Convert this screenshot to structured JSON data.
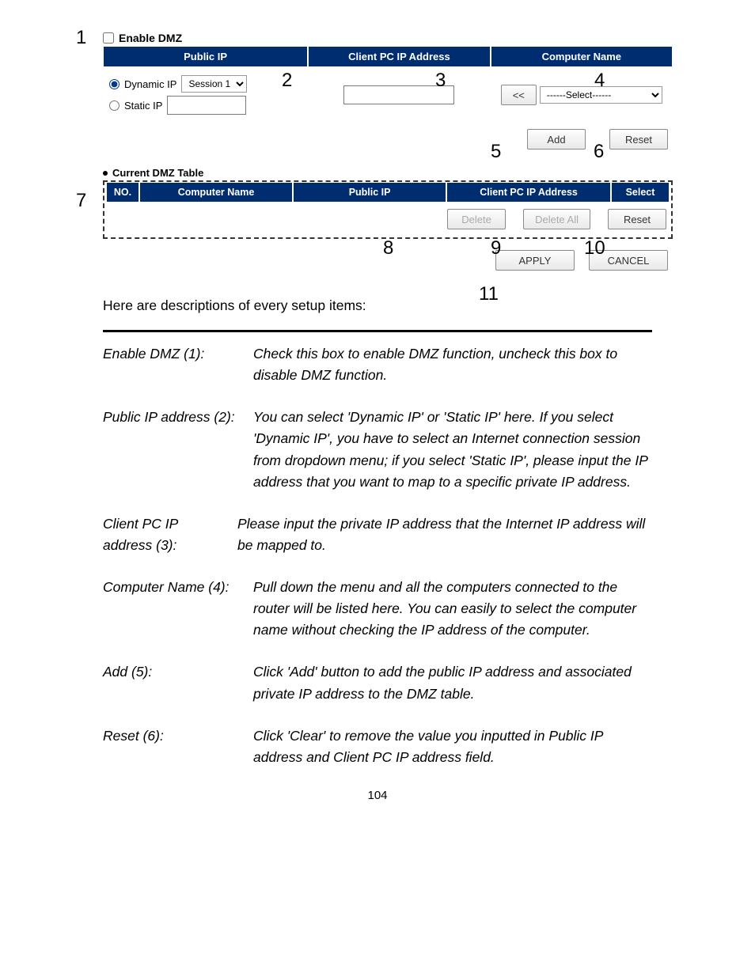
{
  "ui": {
    "enable_label": "Enable DMZ",
    "headers": {
      "public_ip": "Public IP",
      "client_ip": "Client PC IP Address",
      "computer_name": "Computer Name"
    },
    "radios": {
      "dynamic": "Dynamic IP",
      "static": "Static IP"
    },
    "session_selected": "Session 1",
    "client_ip_value": "",
    "computer_lt_btn": "<<",
    "computer_select_placeholder": "------Select------",
    "buttons": {
      "add": "Add",
      "reset": "Reset",
      "delete": "Delete",
      "delete_all": "Delete All",
      "reset_tbl": "Reset",
      "apply": "APPLY",
      "cancel": "CANCEL"
    },
    "table_title": "Current DMZ Table",
    "table_headers": {
      "no": "NO.",
      "computer_name": "Computer Name",
      "public_ip": "Public IP",
      "client_ip": "Client PC IP Address",
      "select": "Select"
    }
  },
  "callouts": {
    "c1": "1",
    "c2": "2",
    "c3": "3",
    "c4": "4",
    "c5": "5",
    "c6": "6",
    "c7": "7",
    "c8": "8",
    "c9": "9",
    "c10": "10",
    "c11": "11"
  },
  "intro": "Here are descriptions of every setup items:",
  "descriptions": [
    {
      "term": "Enable DMZ (1):",
      "def": "Check this box to enable DMZ function, uncheck this box to disable DMZ function."
    },
    {
      "term": "Public IP address (2):",
      "def": "You can select 'Dynamic IP' or 'Static IP' here. If you select 'Dynamic IP', you have to select an Internet connection session from dropdown menu; if you select 'Static IP', please input the IP address that you want to map to a specific private IP address."
    },
    {
      "term": "Client PC IP address (3):",
      "def": "Please input the private IP address that the Internet IP address will be mapped to."
    },
    {
      "term": "Computer Name (4):",
      "def": "Pull down the menu and all the computers connected to the router will be listed here. You can easily to select the computer name without checking the IP address of the computer."
    },
    {
      "term": "Add (5):",
      "def": "Click 'Add' button to add the public IP address and associated private IP address to the DMZ table."
    },
    {
      "term": "Reset (6):",
      "def": "Click 'Clear' to remove the value you inputted in Public IP address and Client PC IP address field."
    }
  ],
  "page_number": "104"
}
